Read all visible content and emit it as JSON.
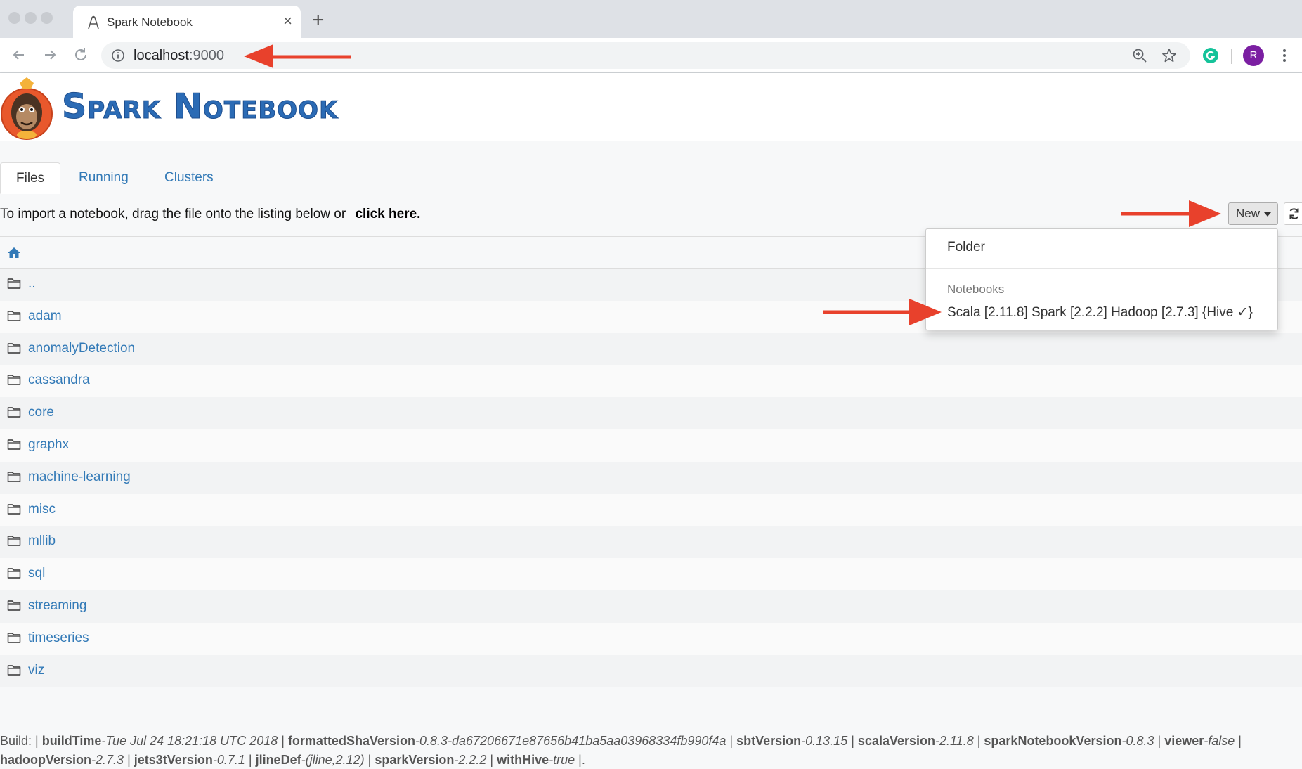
{
  "browser": {
    "tab_title": "Spark Notebook",
    "url_host": "localhost",
    "url_port": ":9000",
    "profile_initial": "R"
  },
  "header": {
    "brand": "Spark Notebook"
  },
  "tabs": [
    {
      "label": "Files",
      "active": true
    },
    {
      "label": "Running",
      "active": false
    },
    {
      "label": "Clusters",
      "active": false
    }
  ],
  "import": {
    "text": "To import a notebook, drag the file onto the listing below or",
    "link": "click here."
  },
  "new_button": {
    "label": "New"
  },
  "dropdown": {
    "folder": "Folder",
    "section_header": "Notebooks",
    "item": "Scala [2.11.8] Spark [2.2.2] Hadoop [2.7.3] {Hive ✓}"
  },
  "files": [
    "..",
    "adam",
    "anomalyDetection",
    "cassandra",
    "core",
    "graphx",
    "machine-learning",
    "misc",
    "mllib",
    "sql",
    "streaming",
    "timeseries",
    "viz"
  ],
  "build": {
    "prefix": "Build: |",
    "items": [
      {
        "key": "buildTime",
        "value": "-Tue Jul 24 18:21:18 UTC 2018"
      },
      {
        "key": "formattedShaVersion",
        "value": "-0.8.3-da67206671e87656b41ba5aa03968334fb990f4a"
      },
      {
        "key": "sbtVersion",
        "value": "-0.13.15"
      },
      {
        "key": "scalaVersion",
        "value": "-2.11.8"
      },
      {
        "key": "sparkNotebookVersion",
        "value": "-0.8.3"
      },
      {
        "key": "viewer",
        "value": "-false"
      },
      {
        "key": "hadoopVersion",
        "value": "-2.7.3"
      },
      {
        "key": "jets3tVersion",
        "value": "-0.7.1"
      },
      {
        "key": "jlineDef",
        "value": "-(jline,2.12)"
      },
      {
        "key": "sparkVersion",
        "value": "-2.2.2"
      },
      {
        "key": "withHive",
        "value": "-true"
      }
    ],
    "suffix": "|."
  },
  "colors": {
    "link": "#337ab7",
    "brand": "#2b6bb5",
    "annotation_arrow": "#e8412c"
  }
}
